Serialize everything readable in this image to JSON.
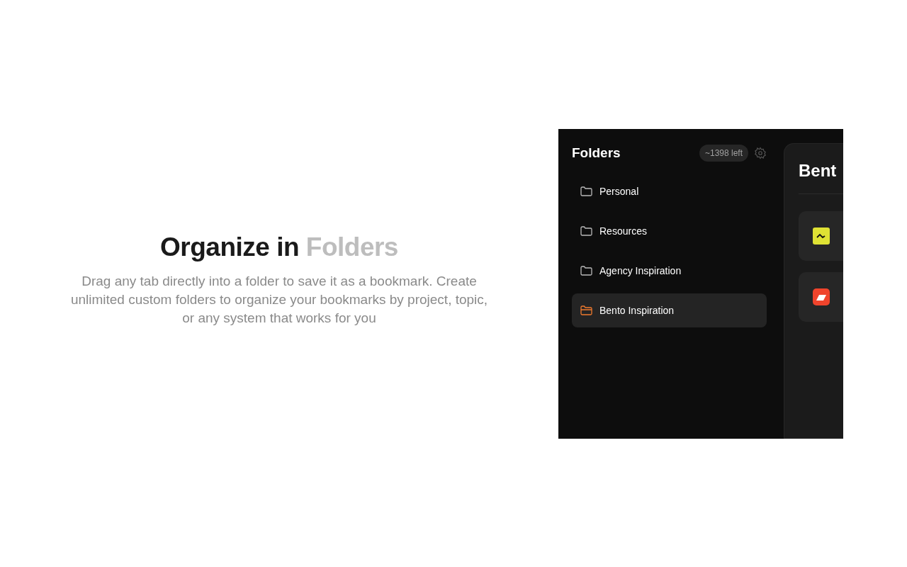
{
  "hero": {
    "title": "Organize in",
    "title_accent": "Folders",
    "description": "Drag any tab directly into a folder to save it as a bookmark. Create unlimited custom folders to organize your bookmarks by project, topic, or any system that works for you"
  },
  "sidebar": {
    "title": "Folders",
    "quota": "~1398 left",
    "items": [
      {
        "label": "Personal",
        "selected": false
      },
      {
        "label": "Resources",
        "selected": false
      },
      {
        "label": "Agency Inspiration",
        "selected": false
      },
      {
        "label": "Bento Inspiration",
        "selected": true
      }
    ]
  },
  "panel": {
    "title": "Bent",
    "bookmarks": [
      {
        "kind": "yellow"
      },
      {
        "kind": "red"
      }
    ]
  }
}
